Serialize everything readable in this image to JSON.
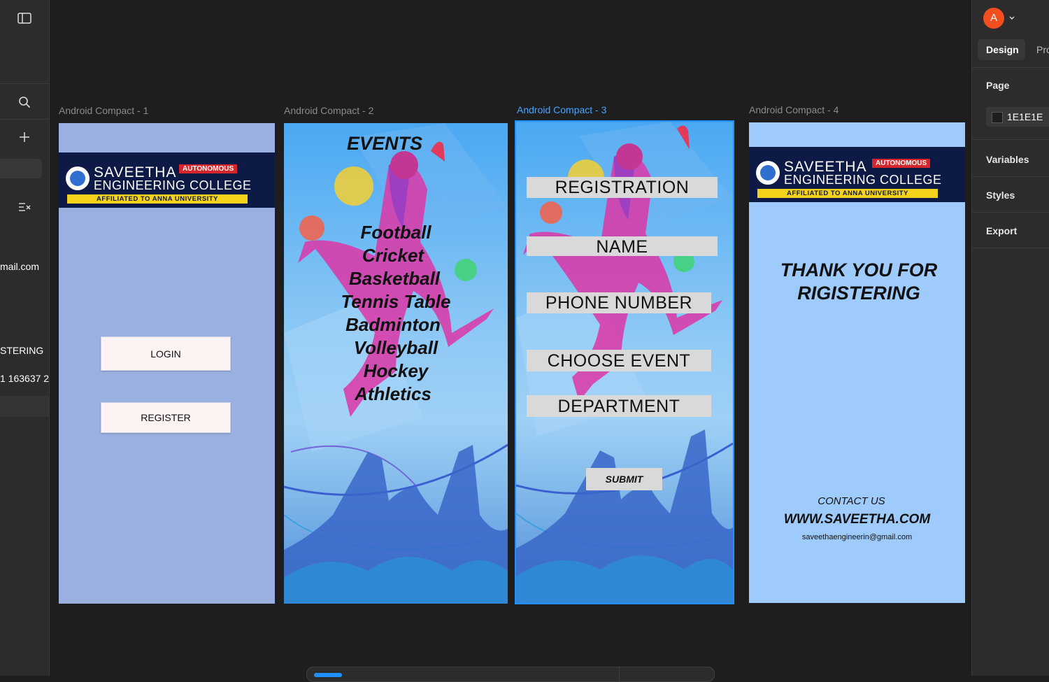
{
  "left_sidebar": {
    "email_fragment": "mail.com",
    "text_fragment_1": "STERING",
    "text_fragment_2": "1 163637 2"
  },
  "frames": [
    {
      "label": "Android Compact - 1"
    },
    {
      "label": "Android Compact - 2"
    },
    {
      "label": "Android Compact - 3"
    },
    {
      "label": "Android Compact - 4"
    }
  ],
  "logo": {
    "name_line1": "SAVEETHA",
    "name_line2": "ENGINEERING COLLEGE",
    "autonomous": "AUTONOMOUS",
    "affiliation": "AFFILIATED TO ANNA UNIVERSITY"
  },
  "frame1": {
    "login_label": "LOGIN",
    "register_label": "REGISTER"
  },
  "frame2": {
    "title": "EVENTS",
    "events": [
      "Football",
      "Cricket",
      "Basketball",
      "Tennis Table",
      "Badminton",
      "Volleyball",
      "Hockey",
      "Athletics"
    ]
  },
  "frame3": {
    "title": "REGISTRATION",
    "fields": [
      "NAME",
      "PHONE NUMBER",
      "CHOOSE EVENT",
      "DEPARTMENT"
    ],
    "submit_label": "SUBMIT"
  },
  "frame4": {
    "thank_line1": "THANK YOU FOR",
    "thank_line2": "RIGISTERING",
    "contact_label": "CONTACT US",
    "website": "WWW.SAVEETHA.COM",
    "email": "saveethaengineerin@gmail.com"
  },
  "right_panel": {
    "avatar_letter": "A",
    "tabs": [
      "Design",
      "Pro"
    ],
    "page_label": "Page",
    "page_color": "1E1E1E",
    "sections": [
      "Variables",
      "Styles",
      "Export"
    ]
  },
  "colors": {
    "canvas": "#1e1e1e",
    "panel": "#2c2c2c",
    "selection": "#1e90ff",
    "avatar": "#f24e1e",
    "frame1_bg": "#9ab0e0",
    "frame4_bg": "#9ecbfb",
    "banner": "#0d1a45"
  }
}
